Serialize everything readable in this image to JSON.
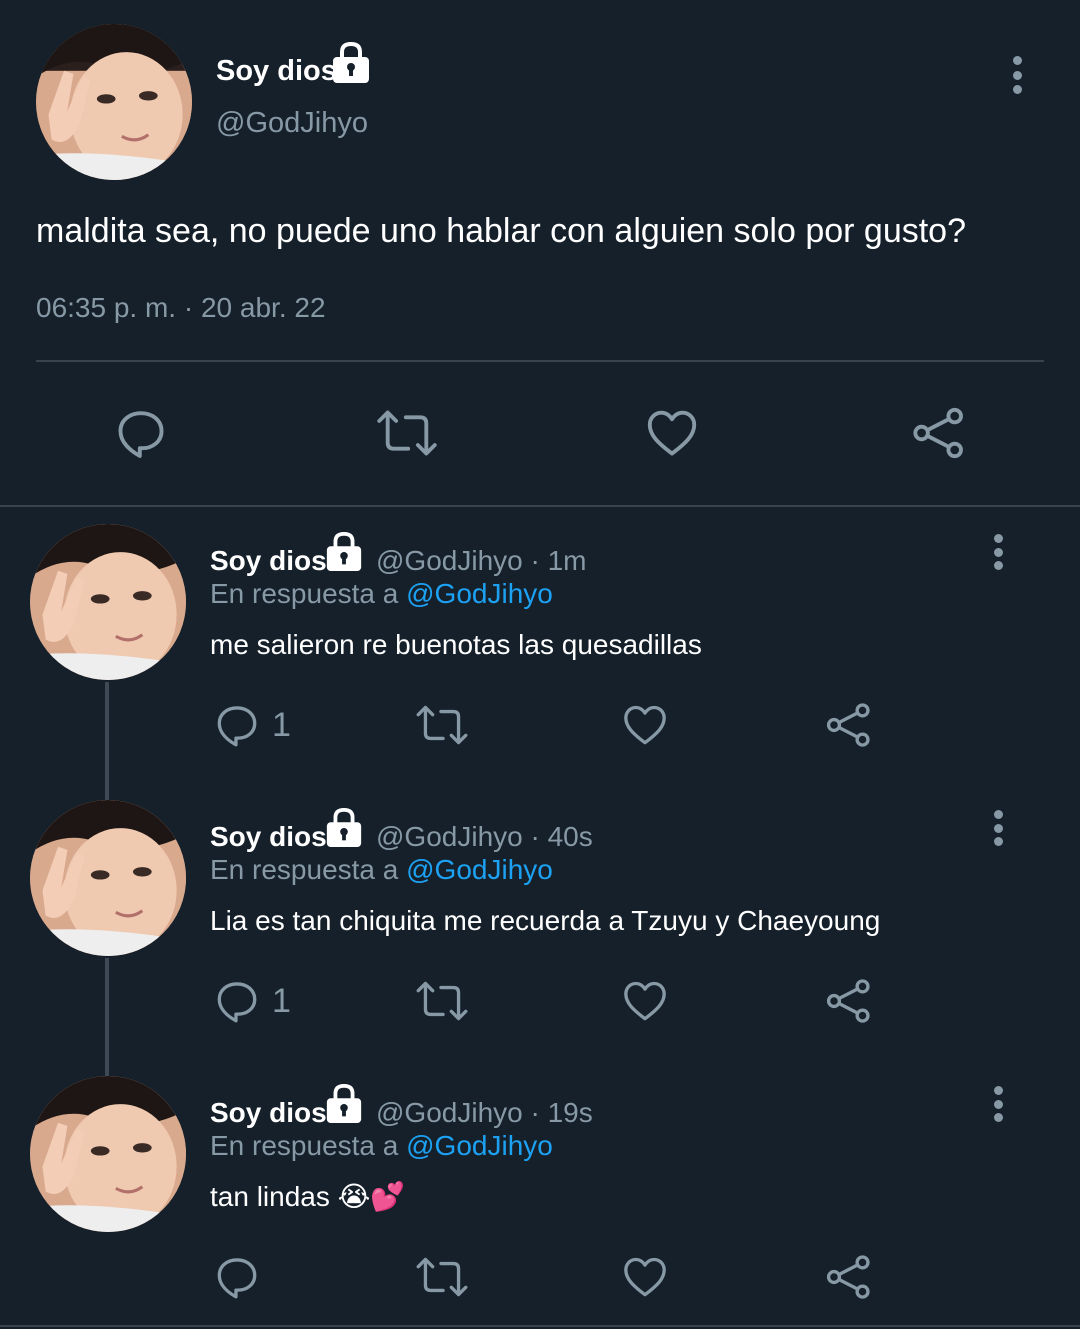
{
  "main_tweet": {
    "display_name": "Soy dios",
    "handle": "@GodJihyo",
    "text": "maldita sea, no puede uno hablar con alguien solo por gusto?",
    "timestamp": "06:35 p. m. · 20 abr. 22",
    "actions": [
      "reply-icon",
      "retweet-icon",
      "like-icon",
      "share-icon"
    ]
  },
  "replies": [
    {
      "display_name": "Soy dios",
      "handle": "@GodJihyo",
      "time": "· 1m",
      "reply_prefix": "En respuesta a",
      "reply_to": "@GodJihyo",
      "text": "me salieron re buenotas las quesadillas",
      "reply_count": "1"
    },
    {
      "display_name": "Soy dios",
      "handle": "@GodJihyo",
      "time": "· 40s",
      "reply_prefix": "En respuesta a",
      "reply_to": "@GodJihyo",
      "text": "Lia es tan chiquita me recuerda a Tzuyu y Chaeyoung",
      "reply_count": "1"
    },
    {
      "display_name": "Soy dios",
      "handle": "@GodJihyo",
      "time": "· 19s",
      "reply_prefix": "En respuesta a",
      "reply_to": "@GodJihyo",
      "text": "tan lindas 😭💕",
      "reply_count": ""
    }
  ],
  "colors": {
    "background": "#15202b",
    "text": "#ffffff",
    "muted": "#8899a6",
    "link": "#1da1f2",
    "divider": "#38444d"
  }
}
